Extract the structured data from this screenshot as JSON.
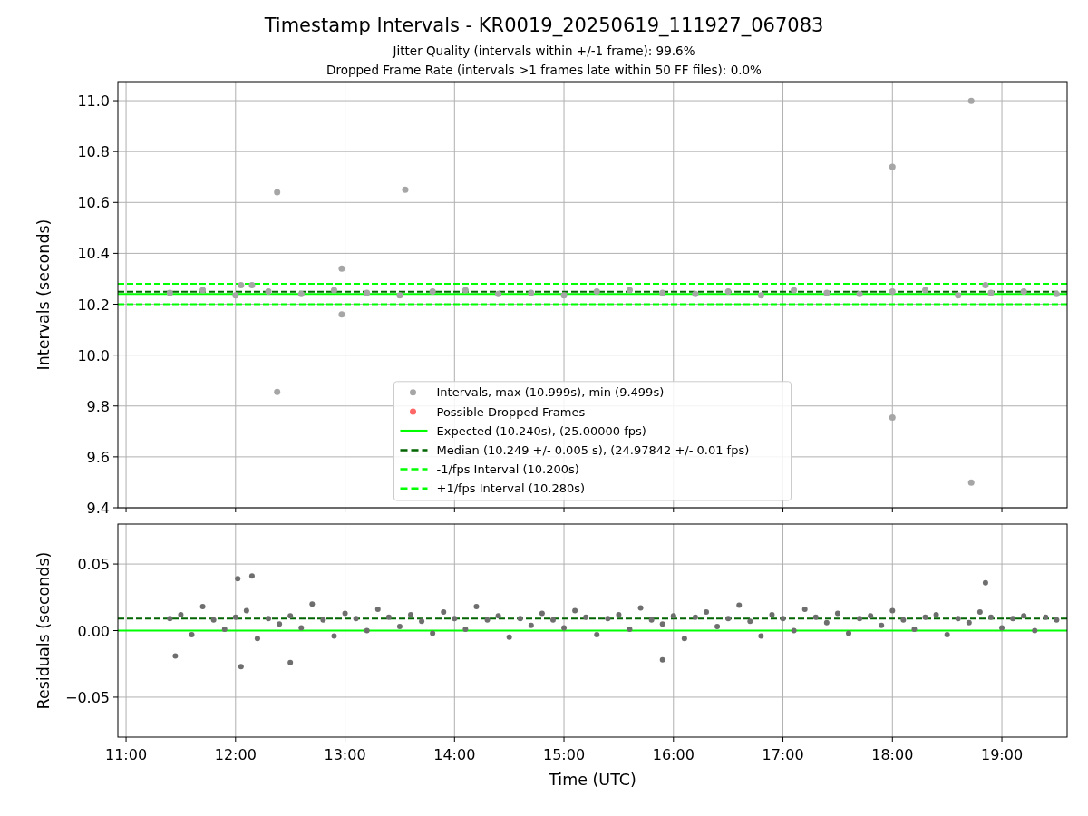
{
  "title": "Timestamp Intervals - KR0019_20250619_111927_067083",
  "subtitles": [
    "Jitter Quality (intervals within +/-1 frame): 99.6%",
    "Dropped Frame Rate (intervals >1 frames late within 50 FF files): 0.0%"
  ],
  "plots": [
    {
      "chart_data": {
        "type": "scatter",
        "ylabel": "Intervals (seconds)",
        "xlim": [
          10.925,
          19.596
        ],
        "ylim": [
          9.4,
          11.075
        ],
        "grid": true,
        "legend": true,
        "yticks": [
          {
            "value": 9.4,
            "label": "9.4"
          },
          {
            "value": 9.6,
            "label": "9.6"
          },
          {
            "value": 9.8,
            "label": "9.8"
          },
          {
            "value": 10.0,
            "label": "10.0"
          },
          {
            "value": 10.2,
            "label": "10.2"
          },
          {
            "value": 10.4,
            "label": "10.4"
          },
          {
            "value": 10.6,
            "label": "10.6"
          },
          {
            "value": 10.8,
            "label": "10.8"
          },
          {
            "value": 11.0,
            "label": "11.0"
          }
        ],
        "series": [
          {
            "name": "Intervals, max (10.999s), min (9.499s)",
            "type": "scatter",
            "color": "#a6a6a6",
            "x": [
              11.4,
              11.7,
              12.0,
              12.3,
              12.6,
              12.9,
              13.2,
              13.5,
              13.8,
              14.1,
              14.4,
              14.7,
              15.0,
              15.3,
              15.6,
              15.9,
              16.2,
              16.5,
              16.8,
              17.1,
              17.4,
              17.7,
              18.0,
              18.3,
              18.6,
              18.9,
              19.2,
              19.5,
              12.05,
              12.15,
              18.85,
              12.38,
              12.38,
              12.97,
              12.97,
              13.55,
              18.0,
              18.0,
              18.72,
              18.72
            ],
            "values": [
              10.245,
              10.255,
              10.235,
              10.25,
              10.24,
              10.255,
              10.245,
              10.235,
              10.25,
              10.255,
              10.24,
              10.245,
              10.235,
              10.25,
              10.255,
              10.245,
              10.24,
              10.25,
              10.235,
              10.255,
              10.245,
              10.24,
              10.25,
              10.255,
              10.235,
              10.245,
              10.25,
              10.24,
              10.275,
              10.275,
              10.275,
              10.64,
              9.855,
              10.34,
              10.16,
              10.65,
              10.74,
              9.755,
              10.999,
              9.499
            ]
          },
          {
            "name": "Possible Dropped Frames",
            "type": "scatter",
            "color": "#ff6666"
          },
          {
            "name": "Expected (10.240s), (25.00000 fps)",
            "type": "line",
            "line_style": "solid",
            "color": "#00ff00",
            "x": [
              10.925,
              19.596
            ],
            "values": [
              10.24,
              10.24
            ]
          },
          {
            "name": "Median (10.249 +/- 0.005 s), (24.97842 +/- 0.01 fps)",
            "type": "line",
            "line_style": "dashed",
            "color": "#006400",
            "x": [
              10.925,
              19.596
            ],
            "values": [
              10.249,
              10.249
            ]
          },
          {
            "name": "-1/fps Interval (10.200s)",
            "type": "line",
            "line_style": "dashed",
            "color": "#00ff00",
            "x": [
              10.925,
              19.596
            ],
            "values": [
              10.2,
              10.2
            ]
          },
          {
            "name": "+1/fps Interval (10.280s)",
            "type": "line",
            "line_style": "dashed",
            "color": "#00ff00",
            "x": [
              10.925,
              19.596
            ],
            "values": [
              10.28,
              10.28
            ]
          }
        ]
      }
    },
    {
      "chart_data": {
        "type": "scatter",
        "xlabel": "Time (UTC)",
        "ylabel": "Residuals (seconds)",
        "xlim": [
          10.925,
          19.596
        ],
        "ylim": [
          -0.08,
          0.08
        ],
        "grid": true,
        "xticks": [
          {
            "value": 11,
            "label": "11:00"
          },
          {
            "value": 12,
            "label": "12:00"
          },
          {
            "value": 13,
            "label": "13:00"
          },
          {
            "value": 14,
            "label": "14:00"
          },
          {
            "value": 15,
            "label": "15:00"
          },
          {
            "value": 16,
            "label": "16:00"
          },
          {
            "value": 17,
            "label": "17:00"
          },
          {
            "value": 18,
            "label": "18:00"
          },
          {
            "value": 19,
            "label": "19:00"
          }
        ],
        "yticks": [
          {
            "value": -0.05,
            "label": "−0.05"
          },
          {
            "value": 0,
            "label": "0.00"
          },
          {
            "value": 0.05,
            "label": "0.05"
          }
        ],
        "series": [
          {
            "type": "scatter",
            "color": "#6e6e6e",
            "x": [
              11.4,
              11.5,
              11.6,
              11.7,
              11.8,
              11.9,
              12.0,
              12.1,
              12.2,
              12.3,
              12.4,
              12.5,
              12.6,
              12.7,
              12.8,
              12.9,
              13.0,
              13.1,
              13.2,
              13.3,
              13.4,
              13.5,
              13.6,
              13.7,
              13.8,
              13.9,
              14.0,
              14.1,
              14.2,
              14.3,
              14.4,
              14.5,
              14.6,
              14.7,
              14.8,
              14.9,
              15.0,
              15.1,
              15.2,
              15.3,
              15.4,
              15.5,
              15.6,
              15.7,
              15.8,
              15.9,
              16.0,
              16.1,
              16.2,
              16.3,
              16.4,
              16.5,
              16.6,
              16.7,
              16.8,
              16.9,
              17.0,
              17.1,
              17.2,
              17.3,
              17.4,
              17.5,
              17.6,
              17.7,
              17.8,
              17.9,
              18.0,
              18.1,
              18.2,
              18.3,
              18.4,
              18.5,
              18.6,
              18.7,
              18.8,
              18.9,
              19.0,
              19.1,
              19.2,
              19.3,
              19.4,
              19.5,
              12.05,
              12.15,
              12.02,
              18.85,
              15.9,
              12.5,
              11.45
            ],
            "values": [
              0.009,
              0.012,
              -0.003,
              0.018,
              0.008,
              0.001,
              0.01,
              0.015,
              -0.006,
              0.009,
              0.005,
              0.011,
              0.002,
              0.02,
              0.008,
              -0.004,
              0.013,
              0.009,
              0.0,
              0.016,
              0.01,
              0.003,
              0.012,
              0.007,
              -0.002,
              0.014,
              0.009,
              0.001,
              0.018,
              0.008,
              0.011,
              -0.005,
              0.009,
              0.004,
              0.013,
              0.008,
              0.002,
              0.015,
              0.01,
              -0.003,
              0.009,
              0.012,
              0.001,
              0.017,
              0.008,
              0.005,
              0.011,
              -0.006,
              0.01,
              0.014,
              0.003,
              0.009,
              0.019,
              0.007,
              -0.004,
              0.012,
              0.009,
              0.0,
              0.016,
              0.01,
              0.006,
              0.013,
              -0.002,
              0.009,
              0.011,
              0.004,
              0.015,
              0.008,
              0.001,
              0.01,
              0.012,
              -0.003,
              0.009,
              0.006,
              0.014,
              0.01,
              0.002,
              0.009,
              0.011,
              0.0,
              0.01,
              0.008,
              -0.027,
              0.041,
              0.039,
              0.036,
              -0.022,
              -0.024,
              -0.019
            ]
          },
          {
            "type": "line",
            "line_style": "solid",
            "color": "#00ff00",
            "x": [
              10.925,
              19.596
            ],
            "values": [
              0,
              0
            ]
          },
          {
            "type": "line",
            "line_style": "dashed",
            "color": "#006400",
            "x": [
              10.925,
              19.596
            ],
            "values": [
              0.009,
              0.009
            ]
          }
        ]
      }
    }
  ]
}
